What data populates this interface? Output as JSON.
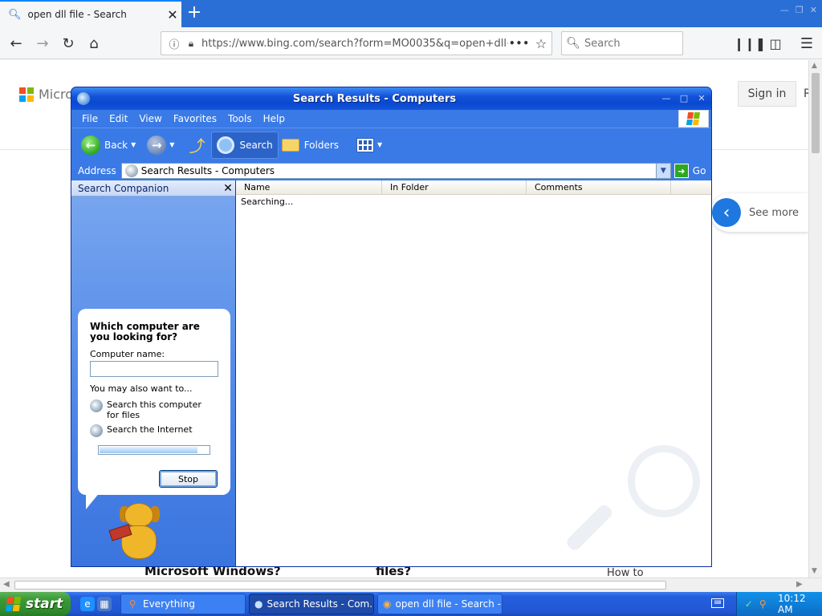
{
  "browser": {
    "tab_title": "open dll file - Search",
    "tab_close": "✕",
    "new_tab": "+",
    "url": "https://www.bing.com/search?form=MO0035&q=open+dll+f",
    "url_dots": "•••",
    "search_placeholder": "Search"
  },
  "bing": {
    "logo_text": "Micros",
    "signin": "Sign in",
    "header_extra": "R",
    "see_more": "See more",
    "bottom_heading_1": "Microsoft Windows?",
    "bottom_heading_2": "files?",
    "bottom_link": "How to"
  },
  "window": {
    "title": "Search Results - Computers",
    "menu": [
      "File",
      "Edit",
      "View",
      "Favorites",
      "Tools",
      "Help"
    ],
    "toolbar": {
      "back": "Back",
      "search": "Search",
      "folders": "Folders"
    },
    "address_label": "Address",
    "address_value": "Search Results - Computers",
    "go": "Go"
  },
  "companion": {
    "title": "Search Companion",
    "question": "Which computer are you looking for?",
    "computer_name_label": "Computer name:",
    "computer_name_value": "",
    "also_want": "You may also want to...",
    "link_search_computer": "Search this computer for files",
    "link_search_internet": "Search the Internet",
    "progress": 0.9,
    "stop": "Stop"
  },
  "results": {
    "columns": [
      "Name",
      "In Folder",
      "Comments"
    ],
    "status": "Searching..."
  },
  "taskbar": {
    "start": "start",
    "tasks": [
      "Everything",
      "Search Results - Com...",
      "open dll file - Search -..."
    ],
    "clock": "10:12 AM"
  }
}
